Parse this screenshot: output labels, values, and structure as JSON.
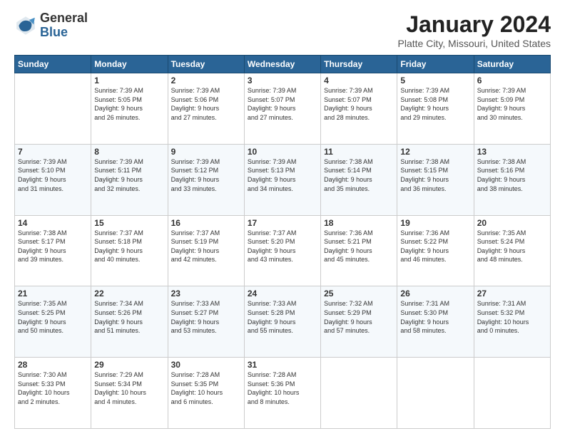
{
  "logo": {
    "general": "General",
    "blue": "Blue"
  },
  "title": "January 2024",
  "location": "Platte City, Missouri, United States",
  "days_of_week": [
    "Sunday",
    "Monday",
    "Tuesday",
    "Wednesday",
    "Thursday",
    "Friday",
    "Saturday"
  ],
  "weeks": [
    [
      {
        "day": "",
        "info": ""
      },
      {
        "day": "1",
        "info": "Sunrise: 7:39 AM\nSunset: 5:05 PM\nDaylight: 9 hours\nand 26 minutes."
      },
      {
        "day": "2",
        "info": "Sunrise: 7:39 AM\nSunset: 5:06 PM\nDaylight: 9 hours\nand 27 minutes."
      },
      {
        "day": "3",
        "info": "Sunrise: 7:39 AM\nSunset: 5:07 PM\nDaylight: 9 hours\nand 27 minutes."
      },
      {
        "day": "4",
        "info": "Sunrise: 7:39 AM\nSunset: 5:07 PM\nDaylight: 9 hours\nand 28 minutes."
      },
      {
        "day": "5",
        "info": "Sunrise: 7:39 AM\nSunset: 5:08 PM\nDaylight: 9 hours\nand 29 minutes."
      },
      {
        "day": "6",
        "info": "Sunrise: 7:39 AM\nSunset: 5:09 PM\nDaylight: 9 hours\nand 30 minutes."
      }
    ],
    [
      {
        "day": "7",
        "info": "Sunrise: 7:39 AM\nSunset: 5:10 PM\nDaylight: 9 hours\nand 31 minutes."
      },
      {
        "day": "8",
        "info": "Sunrise: 7:39 AM\nSunset: 5:11 PM\nDaylight: 9 hours\nand 32 minutes."
      },
      {
        "day": "9",
        "info": "Sunrise: 7:39 AM\nSunset: 5:12 PM\nDaylight: 9 hours\nand 33 minutes."
      },
      {
        "day": "10",
        "info": "Sunrise: 7:39 AM\nSunset: 5:13 PM\nDaylight: 9 hours\nand 34 minutes."
      },
      {
        "day": "11",
        "info": "Sunrise: 7:38 AM\nSunset: 5:14 PM\nDaylight: 9 hours\nand 35 minutes."
      },
      {
        "day": "12",
        "info": "Sunrise: 7:38 AM\nSunset: 5:15 PM\nDaylight: 9 hours\nand 36 minutes."
      },
      {
        "day": "13",
        "info": "Sunrise: 7:38 AM\nSunset: 5:16 PM\nDaylight: 9 hours\nand 38 minutes."
      }
    ],
    [
      {
        "day": "14",
        "info": "Sunrise: 7:38 AM\nSunset: 5:17 PM\nDaylight: 9 hours\nand 39 minutes."
      },
      {
        "day": "15",
        "info": "Sunrise: 7:37 AM\nSunset: 5:18 PM\nDaylight: 9 hours\nand 40 minutes."
      },
      {
        "day": "16",
        "info": "Sunrise: 7:37 AM\nSunset: 5:19 PM\nDaylight: 9 hours\nand 42 minutes."
      },
      {
        "day": "17",
        "info": "Sunrise: 7:37 AM\nSunset: 5:20 PM\nDaylight: 9 hours\nand 43 minutes."
      },
      {
        "day": "18",
        "info": "Sunrise: 7:36 AM\nSunset: 5:21 PM\nDaylight: 9 hours\nand 45 minutes."
      },
      {
        "day": "19",
        "info": "Sunrise: 7:36 AM\nSunset: 5:22 PM\nDaylight: 9 hours\nand 46 minutes."
      },
      {
        "day": "20",
        "info": "Sunrise: 7:35 AM\nSunset: 5:24 PM\nDaylight: 9 hours\nand 48 minutes."
      }
    ],
    [
      {
        "day": "21",
        "info": "Sunrise: 7:35 AM\nSunset: 5:25 PM\nDaylight: 9 hours\nand 50 minutes."
      },
      {
        "day": "22",
        "info": "Sunrise: 7:34 AM\nSunset: 5:26 PM\nDaylight: 9 hours\nand 51 minutes."
      },
      {
        "day": "23",
        "info": "Sunrise: 7:33 AM\nSunset: 5:27 PM\nDaylight: 9 hours\nand 53 minutes."
      },
      {
        "day": "24",
        "info": "Sunrise: 7:33 AM\nSunset: 5:28 PM\nDaylight: 9 hours\nand 55 minutes."
      },
      {
        "day": "25",
        "info": "Sunrise: 7:32 AM\nSunset: 5:29 PM\nDaylight: 9 hours\nand 57 minutes."
      },
      {
        "day": "26",
        "info": "Sunrise: 7:31 AM\nSunset: 5:30 PM\nDaylight: 9 hours\nand 58 minutes."
      },
      {
        "day": "27",
        "info": "Sunrise: 7:31 AM\nSunset: 5:32 PM\nDaylight: 10 hours\nand 0 minutes."
      }
    ],
    [
      {
        "day": "28",
        "info": "Sunrise: 7:30 AM\nSunset: 5:33 PM\nDaylight: 10 hours\nand 2 minutes."
      },
      {
        "day": "29",
        "info": "Sunrise: 7:29 AM\nSunset: 5:34 PM\nDaylight: 10 hours\nand 4 minutes."
      },
      {
        "day": "30",
        "info": "Sunrise: 7:28 AM\nSunset: 5:35 PM\nDaylight: 10 hours\nand 6 minutes."
      },
      {
        "day": "31",
        "info": "Sunrise: 7:28 AM\nSunset: 5:36 PM\nDaylight: 10 hours\nand 8 minutes."
      },
      {
        "day": "",
        "info": ""
      },
      {
        "day": "",
        "info": ""
      },
      {
        "day": "",
        "info": ""
      }
    ]
  ]
}
